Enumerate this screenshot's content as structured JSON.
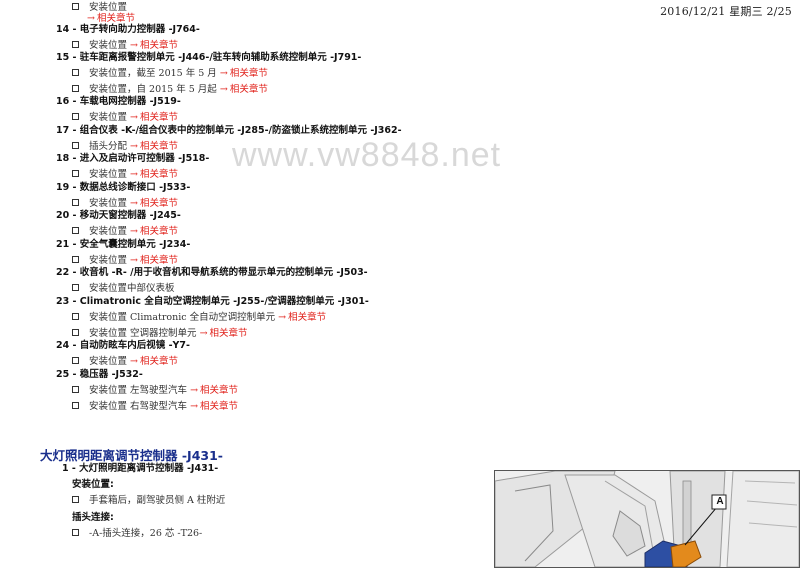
{
  "header": {
    "date": "2016/12/21 星期三 2/25"
  },
  "watermark": "www.vw8848.net",
  "top_list": {
    "first_sub": "安装位置",
    "first_link": "相关章节",
    "items": [
      {
        "label": "14 - 电子转向助力控制器 -J764-",
        "subs": [
          {
            "text": "安装位置",
            "link": "相关章节"
          }
        ]
      },
      {
        "label": "15 - 驻车距离报警控制单元 -J446-/驻车转向辅助系统控制单元 -J791-",
        "subs": [
          {
            "text": "安装位置，截至 2015 年 5 月",
            "link": "相关章节"
          },
          {
            "text": "安装位置，自 2015 年 5 月起",
            "link": "相关章节"
          }
        ]
      },
      {
        "label": "16 - 车载电网控制器 -J519-",
        "subs": [
          {
            "text": "安装位置",
            "link": "相关章节"
          }
        ]
      },
      {
        "label": "17 - 组合仪表 -K-/组合仪表中的控制单元 -J285-/防盗锁止系统控制单元 -J362-",
        "subs": [
          {
            "text": "插头分配",
            "link": "相关章节"
          }
        ]
      },
      {
        "label": "18 - 进入及启动许可控制器 -J518-",
        "subs": [
          {
            "text": "安装位置",
            "link": "相关章节"
          }
        ]
      },
      {
        "label": "19 - 数据总线诊断接口 -J533-",
        "subs": [
          {
            "text": "安装位置",
            "link": "相关章节"
          }
        ]
      },
      {
        "label": "20 - 移动天窗控制器 -J245-",
        "subs": [
          {
            "text": "安装位置",
            "link": "相关章节"
          }
        ]
      },
      {
        "label": "21 - 安全气囊控制单元 -J234-",
        "subs": [
          {
            "text": "安装位置",
            "link": "相关章节"
          }
        ]
      },
      {
        "label": "22 - 收音机 -R- /用于收音机和导航系统的带显示单元的控制单元 -J503-",
        "subs": [
          {
            "text": "安装位置中部仪表板",
            "link": ""
          }
        ]
      },
      {
        "label": "23 - Climatronic 全自动空调控制单元 -J255-/空调器控制单元 -J301-",
        "subs": [
          {
            "text": "安装位置 Climatronic 全自动空调控制单元",
            "link": "相关章节"
          },
          {
            "text": "安装位置 空调器控制单元",
            "link": "相关章节"
          }
        ]
      },
      {
        "label": "24 - 自动防眩车内后视镜 -Y7-",
        "subs": [
          {
            "text": "安装位置",
            "link": "相关章节"
          }
        ]
      },
      {
        "label": "25 - 稳压器 -J532-",
        "subs": [
          {
            "text": "安装位置 左驾驶型汽车",
            "link": "相关章节"
          },
          {
            "text": "安装位置 右驾驶型汽车",
            "link": "相关章节"
          }
        ]
      }
    ]
  },
  "section": {
    "title": "大灯照明距离调节控制器 -J431-",
    "item": "1 - 大灯照明距离调节控制器 -J431-",
    "install_heading": "安装位置:",
    "install_text": "手套箱后，副驾驶员侧 A 柱附近",
    "plug_heading": "插头连接:",
    "plug_text": "-A-插头连接，26 芯 -T26-"
  },
  "figure": {
    "callout_label": "A"
  }
}
